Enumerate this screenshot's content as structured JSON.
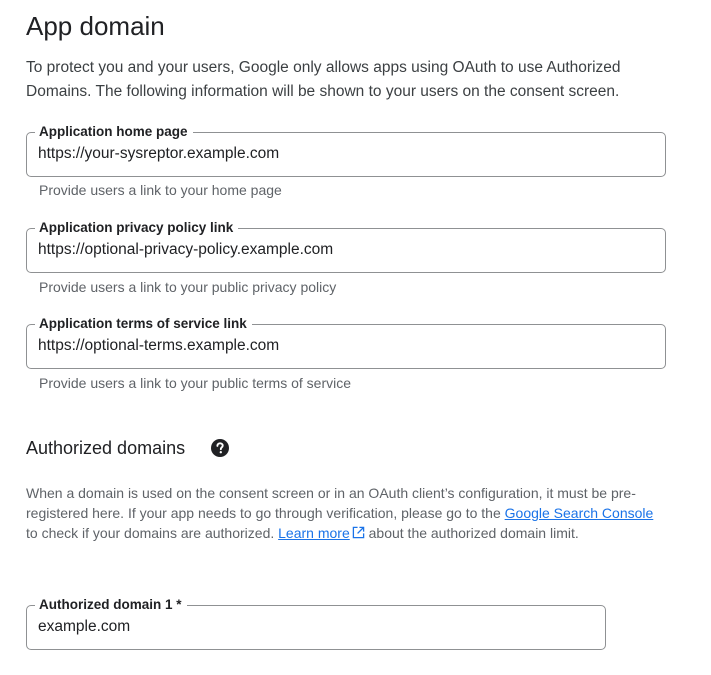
{
  "app_domain": {
    "title": "App domain",
    "intro": "To protect you and your users, Google only allows apps using OAuth to use Authorized Domains. The following information will be shown to your users on the consent screen.",
    "fields": [
      {
        "label": "Application home page",
        "value": "https://your-sysreptor.example.com",
        "hint": "Provide users a link to your home page"
      },
      {
        "label": "Application privacy policy link",
        "value": "https://optional-privacy-policy.example.com",
        "hint": "Provide users a link to your public privacy policy"
      },
      {
        "label": "Application terms of service link",
        "value": "https://optional-terms.example.com",
        "hint": "Provide users a link to your public terms of service"
      }
    ]
  },
  "authorized_domains": {
    "title": "Authorized domains",
    "help_icon": "help-circle-icon",
    "desc_part1": "When a domain is used on the consent screen or in an OAuth client’s configuration, it must be pre-registered here. If your app needs to go through verification, please go to the ",
    "link_search_console": "Google Search Console",
    "desc_part2": " to check if your domains are authorized. ",
    "link_learn_more": "Learn more",
    "external_icon": "open-in-new-icon",
    "desc_part3": " about the authorized domain limit.",
    "domain_field": {
      "label": "Authorized domain 1 *",
      "value": "example.com"
    }
  },
  "colors": {
    "link": "#1a73e8",
    "border": "#8f9193",
    "hint_text": "#5f6368"
  }
}
